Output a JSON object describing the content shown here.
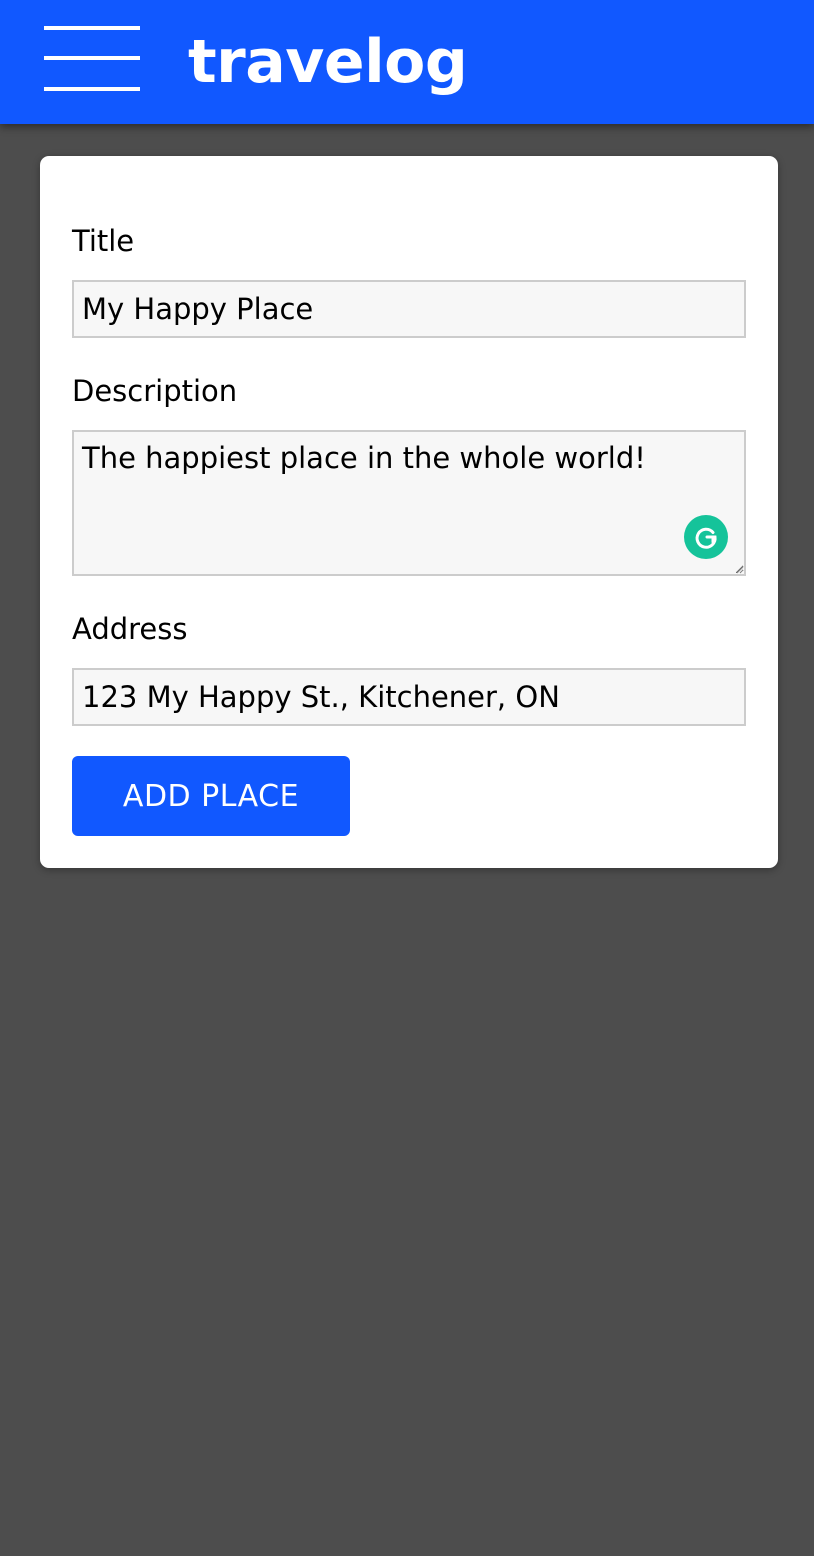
{
  "header": {
    "app_title": "travelog",
    "menu_icon": "hamburger-menu-icon",
    "background_color": "#1158ff"
  },
  "form": {
    "title_label": "Title",
    "title_value": "My Happy Place",
    "description_label": "Description",
    "description_value": "The happiest place in the whole world!",
    "address_label": "Address",
    "address_value": "123 My Happy St., Kitchener, ON",
    "submit_label": "ADD PLACE",
    "grammarly_icon": "grammarly-icon",
    "accent_color": "#1158ff"
  }
}
